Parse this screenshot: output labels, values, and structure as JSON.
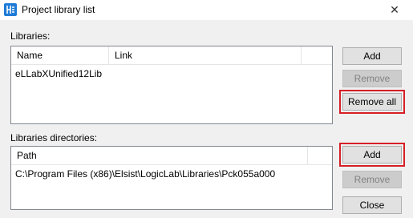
{
  "window": {
    "title": "Project library list",
    "close_glyph": "✕"
  },
  "libraries": {
    "label": "Libraries:",
    "columns": [
      "Name",
      "Link"
    ],
    "rows": [
      {
        "name": "eLLabXUnified12Lib",
        "link": ""
      }
    ],
    "add_label": "Add",
    "remove_label": "Remove",
    "remove_all_label": "Remove all"
  },
  "directories": {
    "label": "Libraries directories:",
    "columns": [
      "Path"
    ],
    "rows": [
      {
        "path": "C:\\Program Files (x86)\\Elsist\\LogicLab\\Libraries\\Pck055a000"
      }
    ],
    "add_label": "Add",
    "remove_label": "Remove"
  },
  "close_label": "Close",
  "colors": {
    "highlight": "#d61f26",
    "app_icon": "#1f7bd6"
  }
}
